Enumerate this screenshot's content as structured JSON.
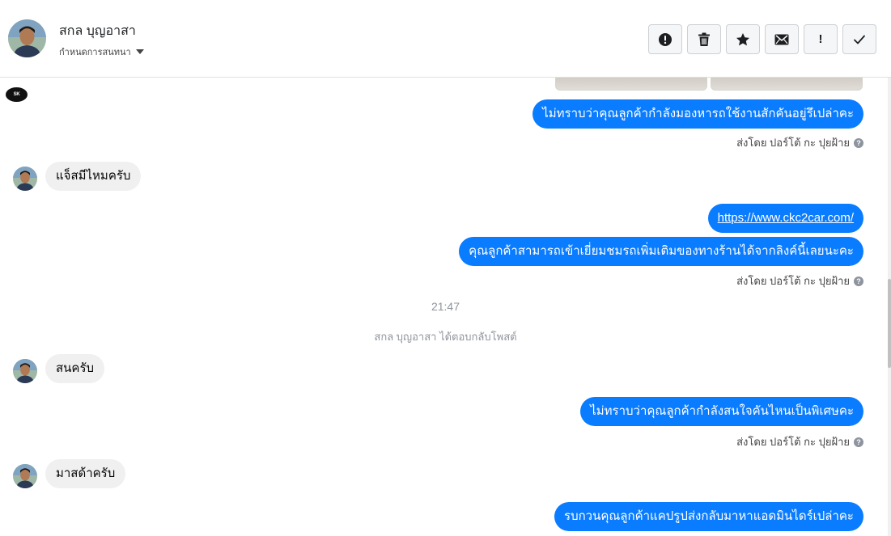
{
  "header": {
    "contact_name": "สกล บุญอาสา",
    "assign_label": "กำหนดการสนทนา",
    "actions": [
      {
        "name": "mark-spam-button",
        "icon": "alert-circle-icon"
      },
      {
        "name": "delete-button",
        "icon": "trash-icon"
      },
      {
        "name": "star-button",
        "icon": "star-icon"
      },
      {
        "name": "mark-unread-button",
        "icon": "envelope-icon"
      },
      {
        "name": "follow-up-button",
        "icon": "exclamation-icon",
        "glyph": "!"
      },
      {
        "name": "mark-done-button",
        "icon": "checkmark-icon"
      }
    ]
  },
  "conversation": {
    "page_logo_text": "SK",
    "messages": {
      "m1": "ไม่ทราบว่าคุณลูกค้ากำลังมองหารถใช้งานสักคันอยู่รึเปล่าคะ",
      "m2": "แจ็สมีไหมครับ",
      "m3": "https://www.ckc2car.com/",
      "m4": "คุณลูกค้าสามารถเข้าเยี่ยมชมรถเพิ่มเติมของทางร้านได้จากลิงค์นี้เลยนะคะ",
      "m5": "สนครับ",
      "m6": "ไม่ทราบว่าคุณลูกค้ากำลังสนใจคันไหนเป็นพิเศษคะ",
      "m7": "มาสด้าครับ",
      "m8": "รบกวนคุณลูกค้าแคปรูปส่งกลับมาหาแอดมินไดร์เปล่าคะ"
    },
    "sent_by": "ส่งโดย ปอร์โต้ กะ ปุยฝ้าย",
    "help_glyph": "?",
    "timestamp": "21:47",
    "reply_notice": "สกล บุญอาสา ได้ตอบกลับโพสต์"
  },
  "colors": {
    "outgoing_bubble": "#0a7cff",
    "incoming_bubble": "#f0f0f0",
    "meta_text": "#90949c"
  }
}
